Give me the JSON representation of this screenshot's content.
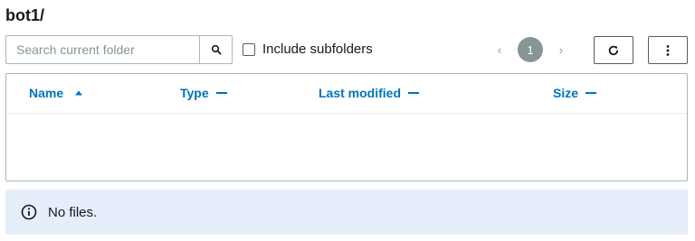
{
  "header": {
    "title": "bot1/"
  },
  "search": {
    "placeholder": "Search current folder",
    "value": ""
  },
  "subfolders": {
    "label": "Include subfolders",
    "checked": false
  },
  "pagination": {
    "prev_label": "‹",
    "current_page": "1",
    "next_label": "›"
  },
  "table": {
    "columns": [
      {
        "label": "Name",
        "sort": "ascending"
      },
      {
        "label": "Type",
        "sort": "none"
      },
      {
        "label": "Last modified",
        "sort": "none"
      },
      {
        "label": "Size",
        "sort": "none"
      }
    ],
    "rows": []
  },
  "alert": {
    "message": "No files.",
    "icon": "info-icon"
  },
  "colors": {
    "link": "#0073bb",
    "alert_bg": "#e6eefb",
    "page_badge": "#879596",
    "text": "#16191f"
  }
}
